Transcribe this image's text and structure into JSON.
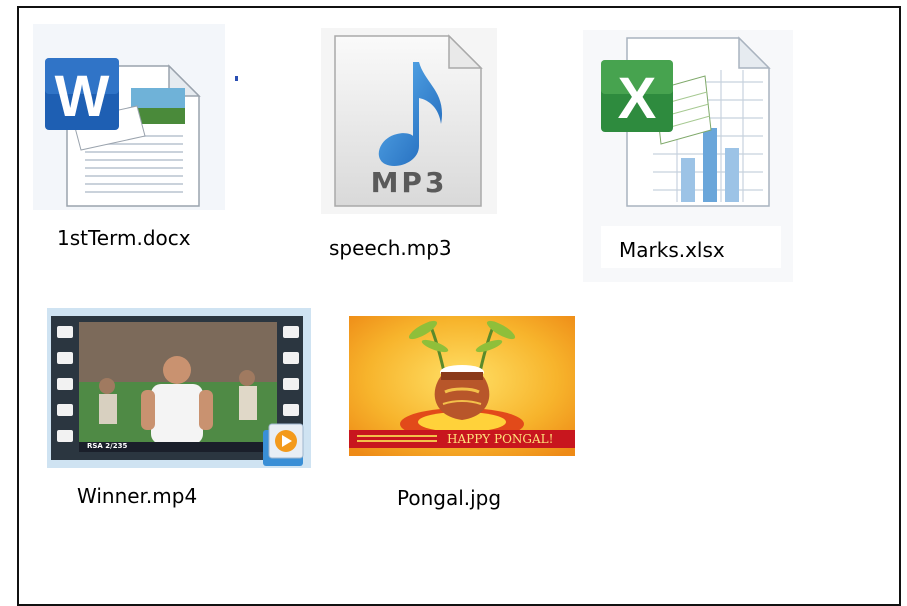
{
  "window": {
    "title": ""
  },
  "files": [
    {
      "name": "1stTerm.docx",
      "type": "word-document",
      "icon": "word-doc-icon"
    },
    {
      "name": "speech.mp3",
      "type": "audio",
      "icon": "mp3-audio-icon",
      "icon_text": "MP3"
    },
    {
      "name": "Marks.xlsx",
      "type": "excel-spreadsheet",
      "icon": "excel-sheet-icon"
    },
    {
      "name": "Winner.mp4",
      "type": "video",
      "icon": "video-thumbnail",
      "score_overlay": "RSA 2/235"
    },
    {
      "name": "Pongal.jpg",
      "type": "image",
      "icon": "image-thumbnail",
      "banner_text": "HAPPY PONGAL!"
    }
  ],
  "colors": {
    "word_blue": "#1e5fb3",
    "mp3_blue": "#2f86d8",
    "excel_green": "#2e8b3e",
    "pongal_orange": "#f39a1c",
    "pongal_red": "#c8161e",
    "border": "#111111"
  }
}
